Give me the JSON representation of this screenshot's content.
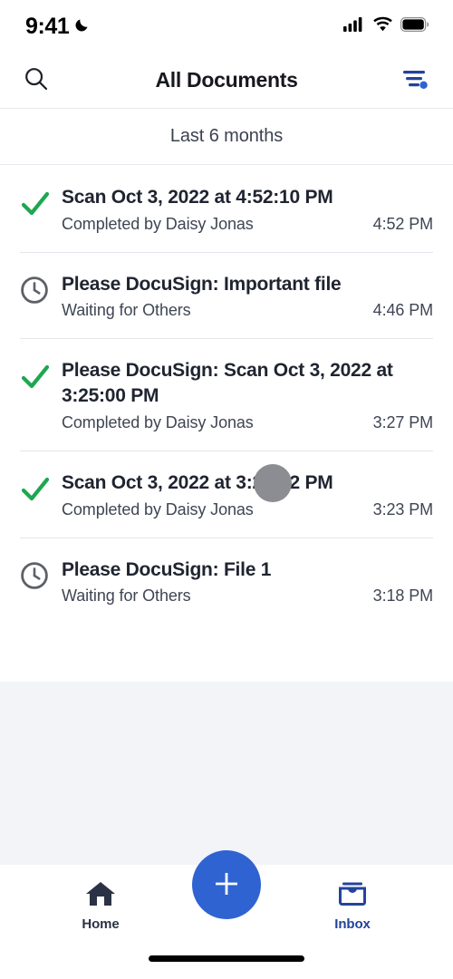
{
  "status_bar": {
    "time": "9:41",
    "moon_icon": "crescent-moon-icon",
    "signal_icon": "cellular-signal-icon",
    "wifi_icon": "wifi-icon",
    "battery_icon": "battery-full-icon"
  },
  "header": {
    "title": "All Documents",
    "search_icon": "search-icon",
    "filter_icon": "filter-icon",
    "filter_badge_color": "#2f63d1"
  },
  "section": {
    "label": "Last 6 months"
  },
  "documents": [
    {
      "status": "completed",
      "status_icon": "green-checkmark-icon",
      "title": "Scan Oct 3, 2022 at 4:52:10 PM",
      "subtitle": "Completed by Daisy Jonas",
      "time": "4:52 PM"
    },
    {
      "status": "waiting",
      "status_icon": "clock-icon",
      "title": "Please DocuSign: Important file",
      "subtitle": "Waiting for Others",
      "time": "4:46 PM"
    },
    {
      "status": "completed",
      "status_icon": "green-checkmark-icon",
      "title": "Please DocuSign: Scan Oct 3, 2022 at 3:25:00 PM",
      "subtitle": "Completed by Daisy Jonas",
      "time": "3:27 PM"
    },
    {
      "status": "completed",
      "status_icon": "green-checkmark-icon",
      "title": "Scan Oct 3, 2022 at 3:22:12 PM",
      "subtitle": "Completed by Daisy Jonas",
      "time": "3:23 PM"
    },
    {
      "status": "waiting",
      "status_icon": "clock-icon",
      "title": "Please DocuSign: File 1",
      "subtitle": "Waiting for Others",
      "time": "3:18 PM"
    }
  ],
  "bottom_nav": {
    "home_label": "Home",
    "home_icon": "home-icon",
    "inbox_label": "Inbox",
    "inbox_icon": "inbox-icon",
    "fab_icon": "plus-icon",
    "fab_color": "#2f63d1"
  },
  "colors": {
    "accent_blue": "#2f63d1",
    "inbox_blue": "#23439c",
    "success_green": "#1da750",
    "pending_gray": "#5e6068",
    "page_background": "#f3f4f8"
  }
}
